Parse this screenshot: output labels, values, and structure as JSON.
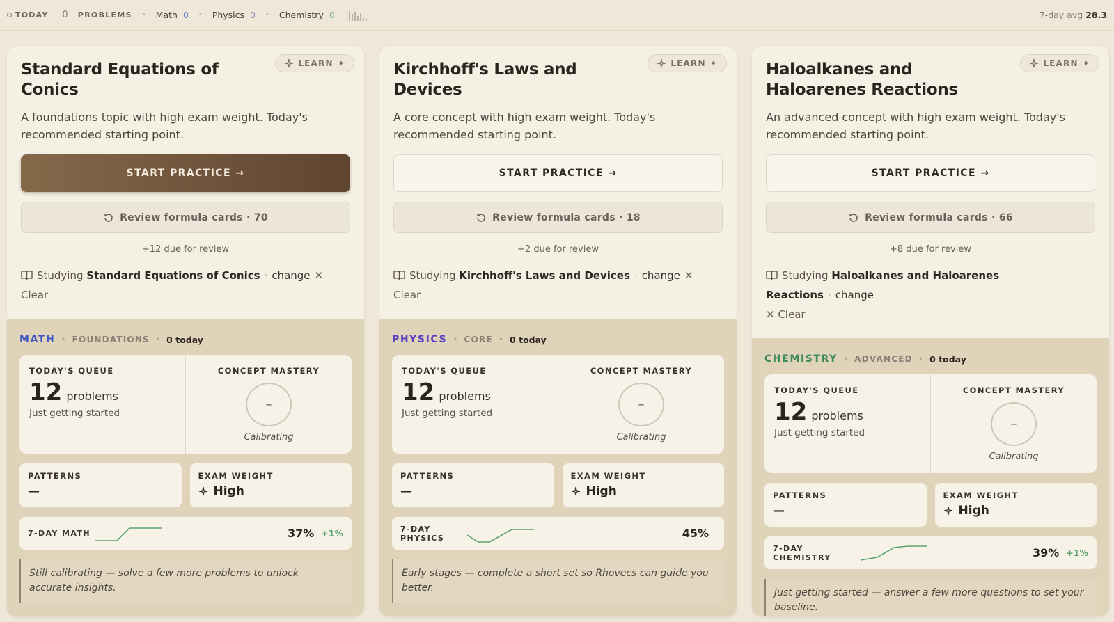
{
  "topbar": {
    "today_label": "TODAY",
    "problems_count": "0",
    "problems_label": "PROBLEMS",
    "subjects": [
      {
        "name": "Math",
        "count": "0"
      },
      {
        "name": "Physics",
        "count": "0"
      },
      {
        "name": "Chemistry",
        "count": "0"
      }
    ],
    "avg_label": "7-day avg",
    "avg_value": "28.3"
  },
  "cards": [
    {
      "title": "Standard Equations of Conics",
      "learn_label": "LEARN",
      "description": "A foundations topic with high exam weight. Today's recommended starting point.",
      "start_label": "START PRACTICE →",
      "review_label": "Review formula cards · 70",
      "due_text": "+12 due for review",
      "studying_prefix": "Studying",
      "studying_topic": "Standard Equations of Conics",
      "change_label": "change",
      "clear_label": "✕ Clear",
      "subject": "MATH",
      "subject_color": "#3d56c4",
      "level": "FOUNDATIONS",
      "today_count": "0 today",
      "queue_label": "TODAY'S QUEUE",
      "queue_value": "12",
      "queue_unit": "problems",
      "queue_sub": "Just getting started",
      "mastery_label": "CONCEPT MASTERY",
      "mastery_value": "–",
      "mastery_status": "Calibrating",
      "patterns_label": "PATTERNS",
      "patterns_value": "—",
      "weight_label": "EXAM WEIGHT",
      "weight_value": "High",
      "trend_label": "7-DAY MATH",
      "trend_pct": "37%",
      "trend_delta": "+1%",
      "note": "Still calibrating — solve a few more problems to unlock accurate insights."
    },
    {
      "title": "Kirchhoff's Laws and Devices",
      "learn_label": "LEARN",
      "description": "A core concept with high exam weight. Today's recommended starting point.",
      "start_label": "START PRACTICE →",
      "review_label": "Review formula cards · 18",
      "due_text": "+2 due for review",
      "studying_prefix": "Studying",
      "studying_topic": "Kirchhoff's Laws and Devices",
      "change_label": "change",
      "clear_label": "✕ Clear",
      "subject": "PHYSICS",
      "subject_color": "#5a3fc0",
      "level": "CORE",
      "today_count": "0 today",
      "queue_label": "TODAY'S QUEUE",
      "queue_value": "12",
      "queue_unit": "problems",
      "queue_sub": "Just getting started",
      "mastery_label": "CONCEPT MASTERY",
      "mastery_value": "–",
      "mastery_status": "Calibrating",
      "patterns_label": "PATTERNS",
      "patterns_value": "—",
      "weight_label": "EXAM WEIGHT",
      "weight_value": "High",
      "trend_label": "7-DAY PHYSICS",
      "trend_pct": "45%",
      "trend_delta": "",
      "note": "Early stages — complete a short set so Rhovecs can guide you better."
    },
    {
      "title": "Haloalkanes and Haloarenes Reactions",
      "learn_label": "LEARN",
      "description": "An advanced concept with high exam weight. Today's recommended starting point.",
      "start_label": "START PRACTICE →",
      "review_label": "Review formula cards · 66",
      "due_text": "+8 due for review",
      "studying_prefix": "Studying",
      "studying_topic": "Haloalkanes and Haloarenes Reactions",
      "change_label": "change",
      "clear_label": "✕ Clear",
      "subject": "CHEMISTRY",
      "subject_color": "#3f8a5a",
      "level": "ADVANCED",
      "today_count": "0 today",
      "queue_label": "TODAY'S QUEUE",
      "queue_value": "12",
      "queue_unit": "problems",
      "queue_sub": "Just getting started",
      "mastery_label": "CONCEPT MASTERY",
      "mastery_value": "–",
      "mastery_status": "Calibrating",
      "patterns_label": "PATTERNS",
      "patterns_value": "—",
      "weight_label": "EXAM WEIGHT",
      "weight_value": "High",
      "trend_label": "7-DAY CHEMISTRY",
      "trend_pct": "39%",
      "trend_delta": "+1%",
      "note": "Just getting started — answer a few more questions to set your baseline."
    }
  ]
}
